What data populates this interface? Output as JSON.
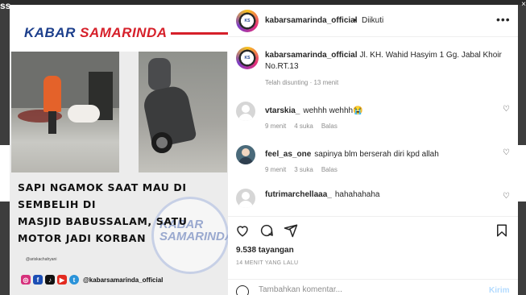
{
  "window": {
    "top_left_label": "ss",
    "close_glyph": "×"
  },
  "media": {
    "brand_part1": "KABAR ",
    "brand_part2": "SAMARINDA",
    "headline": "SAPI NGAMOK SAAT MAU DI SEMBELIH DI\nMASJID BABUSSALAM, SATU\nMOTOR JADI KORBAN",
    "watermark": "KABAR\nSAMARINDA",
    "credit": "@ariskachahyani",
    "social_handle": "@kabarsamarinda_official",
    "social_icons": [
      "instagram-icon",
      "facebook-icon",
      "tiktok-icon",
      "youtube-icon",
      "twitter-icon"
    ]
  },
  "header": {
    "username": "kabarsamarinda_official",
    "separator": "•",
    "follow_state": "Diikuti",
    "more": "•••"
  },
  "caption": {
    "username": "kabarsamarinda_official",
    "text": "Jl. KH. Wahid Hasyim 1 Gg. Jabal Khoir No.RT.13",
    "meta": "Telah disunting · 13 menit"
  },
  "comments": [
    {
      "username": "vtarskia_",
      "text": "wehhh wehhh😭",
      "time": "9 menit",
      "likes": "4 suka",
      "reply": "Balas"
    },
    {
      "username": "feel_as_one",
      "text": "sapinya blm berserah diri kpd allah",
      "time": "9 menit",
      "likes": "3 suka",
      "reply": "Balas"
    },
    {
      "username": "futrimarchellaaa_",
      "text": "hahahahaha",
      "time": "",
      "likes": "",
      "reply": ""
    }
  ],
  "stats": {
    "views": "9.538 tayangan",
    "time_ago": "14 MENIT YANG LALU"
  },
  "add_comment": {
    "placeholder": "Tambahkan komentar...",
    "post_label": "Kirim"
  },
  "colors": {
    "brand_blue": "#1d3f8c",
    "brand_red": "#d6202a",
    "post_button": "#b3dbff",
    "meta_gray": "#8e8e8e"
  }
}
